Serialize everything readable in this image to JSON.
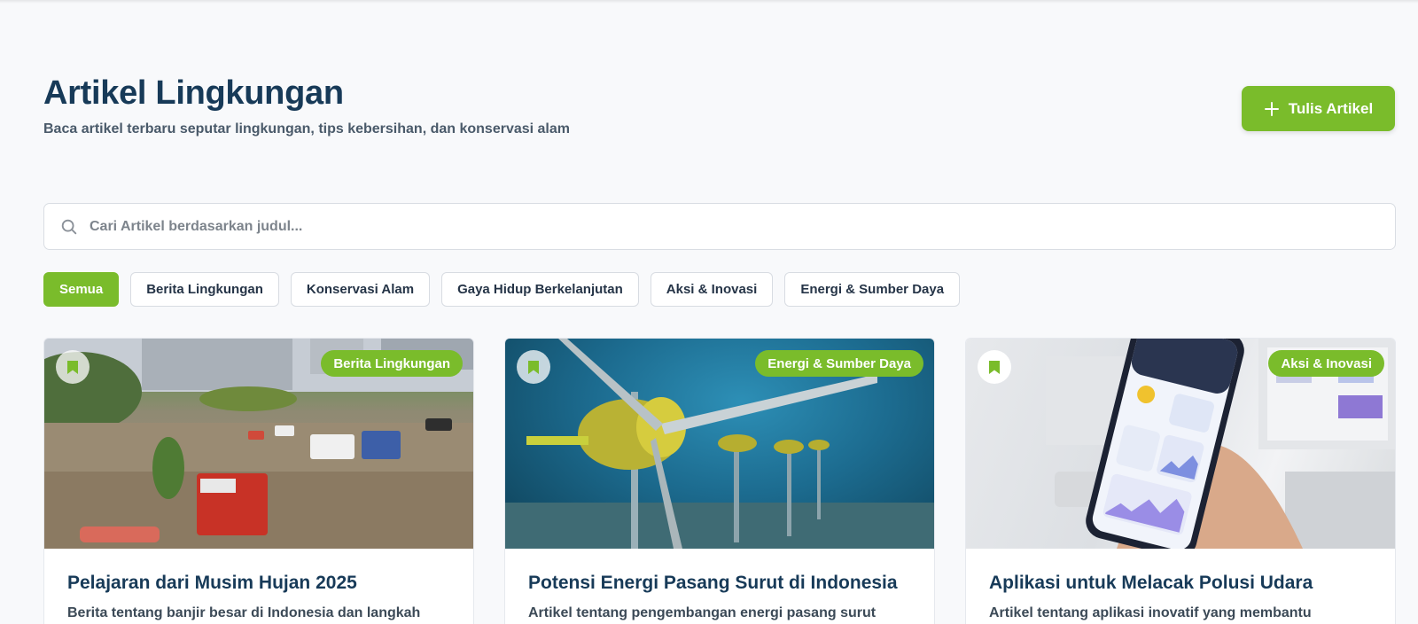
{
  "header": {
    "title": "Artikel Lingkungan",
    "subtitle": "Baca artikel terbaru seputar lingkungan, tips kebersihan, dan konservasi alam",
    "write_button_label": "Tulis Artikel",
    "write_button_icon": "plus-icon"
  },
  "search": {
    "placeholder": "Cari Artikel berdasarkan judul...",
    "value": "",
    "icon": "search-icon"
  },
  "filters": [
    {
      "label": "Semua",
      "active": true
    },
    {
      "label": "Berita Lingkungan",
      "active": false
    },
    {
      "label": "Konservasi Alam",
      "active": false
    },
    {
      "label": "Gaya Hidup Berkelanjutan",
      "active": false
    },
    {
      "label": "Aksi & Inovasi",
      "active": false
    },
    {
      "label": "Energi & Sumber Daya",
      "active": false
    }
  ],
  "articles": [
    {
      "category": "Berita Lingkungan",
      "title": "Pelajaran dari Musim Hujan 2025",
      "excerpt": "Berita tentang banjir besar di Indonesia dan langkah",
      "image": "flooded-city-street-photo",
      "bookmark_icon": "bookmark-icon"
    },
    {
      "category": "Energi & Sumber Daya",
      "title": "Potensi Energi Pasang Surut di Indonesia",
      "excerpt": "Artikel tentang pengembangan energi pasang surut",
      "image": "underwater-tidal-turbines-photo",
      "bookmark_icon": "bookmark-icon"
    },
    {
      "category": "Aksi & Inovasi",
      "title": "Aplikasi untuk Melacak Polusi Udara",
      "excerpt": "Artikel tentang aplikasi inovatif yang membantu",
      "image": "phone-air-quality-app-photo",
      "bookmark_icon": "bookmark-icon"
    }
  ],
  "colors": {
    "accent": "#7abc2b",
    "title": "#173a58",
    "background": "#f8f9fb"
  }
}
